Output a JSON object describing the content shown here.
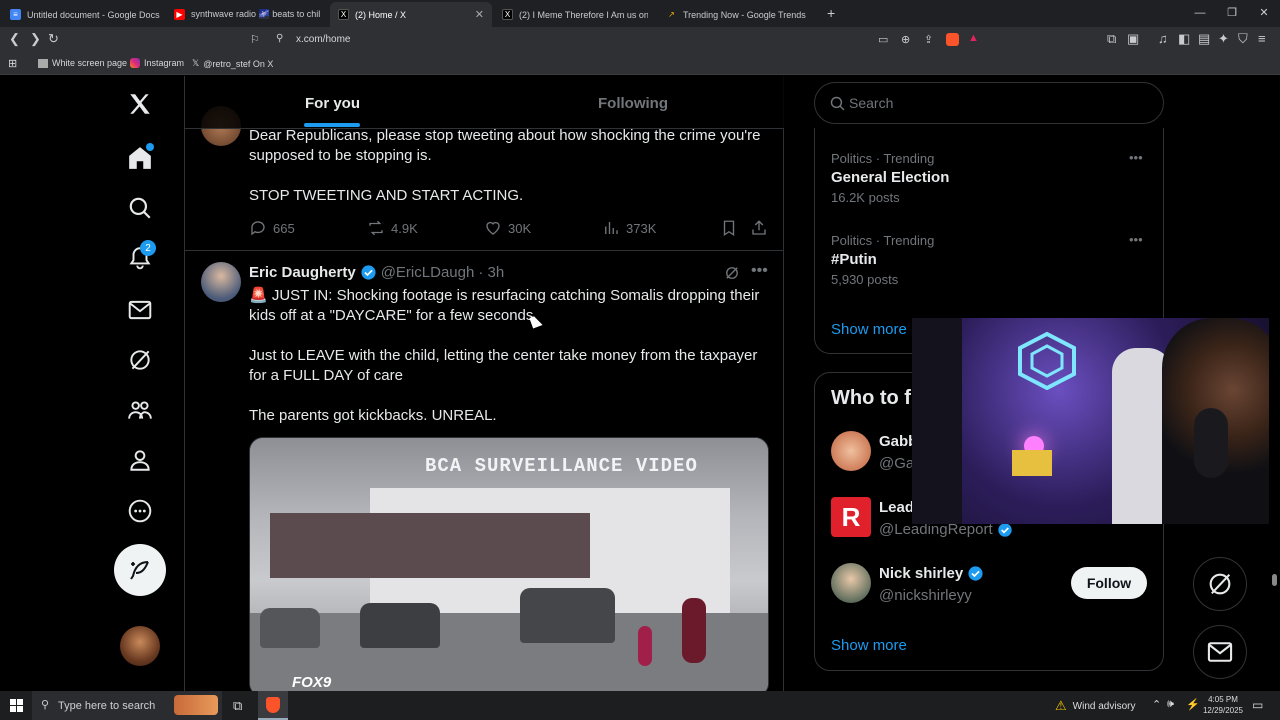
{
  "browser": {
    "tabs": [
      {
        "title": "Untitled document - Google Docs"
      },
      {
        "title": "synthwave radio 🌌 beats to chill"
      },
      {
        "title": "(2) Home / X"
      },
      {
        "title": "(2) I Meme Therefore I Am us on X: \""
      },
      {
        "title": "Trending Now - Google Trends"
      }
    ],
    "url": "x.com/home",
    "bookmarks": [
      "White screen page",
      "Instagram",
      "@retro_stef On X"
    ]
  },
  "nav": {
    "notification_count": "2"
  },
  "feed": {
    "tabs": [
      "For you",
      "Following"
    ],
    "post1": {
      "text_line1": "Dear Republicans, please stop tweeting about how shocking the crime you're",
      "text_line2": "supposed to be stopping is.",
      "text_line3": "STOP TWEETING AND START ACTING.",
      "replies": "665",
      "reposts": "4.9K",
      "likes": "30K",
      "views": "373K"
    },
    "post2": {
      "author": "Eric Daugherty",
      "handle": "@EricLDaugh",
      "time": "· 3h",
      "line1": "🚨 JUST IN: Shocking footage is resurfacing catching Somalis dropping their",
      "line2": "kids off at a \"DAYCARE\" for a few seconds",
      "line3": "Just to LEAVE with the child, letting the center take money from the taxpayer",
      "line4": "for a FULL DAY of care",
      "line5": "The parents got kickbacks. UNREAL.",
      "video_caption": "BCA SURVEILLANCE VIDEO",
      "video_logo": "FOX9"
    }
  },
  "sidebar": {
    "search_placeholder": "Search",
    "trends": [
      {
        "context": "Politics · Trending",
        "title": "General Election",
        "posts": "16.2K posts"
      },
      {
        "context": "Politics · Trending",
        "title": "#Putin",
        "posts": "5,930 posts"
      }
    ],
    "show_more": "Show more",
    "who_to_follow_title": "Who to f",
    "accounts": [
      {
        "name": "Gabb",
        "handle": "@Ga"
      },
      {
        "name": "Lead",
        "handle": "@LeadingReport"
      },
      {
        "name": "Nick shirley",
        "handle": "@nickshirleyy",
        "button": "Follow"
      }
    ],
    "show_more_2": "Show more"
  },
  "taskbar": {
    "search_placeholder": "Type here to search",
    "weather": "Wind advisory",
    "time": "4:05 PM",
    "date": "12/29/2025"
  },
  "colors": {
    "accent": "#1d9bf0",
    "background": "#000000",
    "border": "#2f3336"
  }
}
